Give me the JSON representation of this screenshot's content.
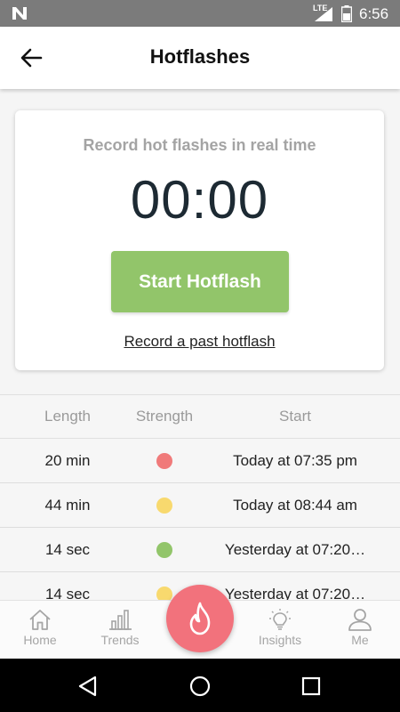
{
  "status_bar": {
    "network": "LTE",
    "time": "6:56"
  },
  "app_bar": {
    "title": "Hotflashes"
  },
  "record_card": {
    "subtitle": "Record hot flashes in real time",
    "timer": "00:00",
    "start_button": "Start Hotflash",
    "past_link": "Record a past hotflash"
  },
  "table": {
    "headers": {
      "length": "Length",
      "strength": "Strength",
      "start": "Start"
    },
    "rows": [
      {
        "length": "20 min",
        "strength_color": "#f07a7a",
        "start": "Today at 07:35 pm"
      },
      {
        "length": "44 min",
        "strength_color": "#f8d96e",
        "start": "Today at 08:44 am"
      },
      {
        "length": "14 sec",
        "strength_color": "#92c56a",
        "start": "Yesterday at 07:20…"
      },
      {
        "length": "14 sec",
        "strength_color": "#f8d96e",
        "start": "Yesterday at 07:20…"
      }
    ]
  },
  "bottom_nav": {
    "items": [
      {
        "label": "Home",
        "icon": "home-icon"
      },
      {
        "label": "Trends",
        "icon": "bar-chart-icon"
      },
      {
        "label": "Insights",
        "icon": "lightbulb-icon"
      },
      {
        "label": "Me",
        "icon": "person-icon"
      }
    ],
    "fab_icon": "flame-icon",
    "fab_color": "#f2727c"
  },
  "colors": {
    "accent_green": "#92c56a",
    "text_dark": "#1d2a33",
    "muted": "#a4a4a4"
  }
}
